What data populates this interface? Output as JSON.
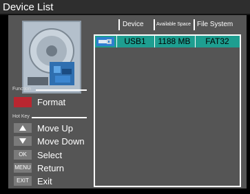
{
  "window": {
    "title": "Device List"
  },
  "sidebar": {
    "function_label": "Function",
    "functions": [
      {
        "key": "",
        "label": "Format",
        "color": "#b92630"
      }
    ],
    "hotkey_label": "Hot Key",
    "hotkeys": [
      {
        "key": "",
        "icon": "arrow-up-icon",
        "label": "Move Up"
      },
      {
        "key": "",
        "icon": "arrow-down-icon",
        "label": "Move Down"
      },
      {
        "key": "OK",
        "label": "Select"
      },
      {
        "key": "MENU",
        "label": "Return"
      },
      {
        "key": "EXIT",
        "label": "Exit"
      }
    ]
  },
  "device_table": {
    "columns": [
      "Device",
      "Available Space",
      "File System"
    ],
    "rows": [
      {
        "icon": "usb-drive-icon",
        "device": "USB1",
        "available_space": "1188 MB",
        "file_system": "FAT32"
      }
    ],
    "selected_row_color": "#1e9e90"
  }
}
